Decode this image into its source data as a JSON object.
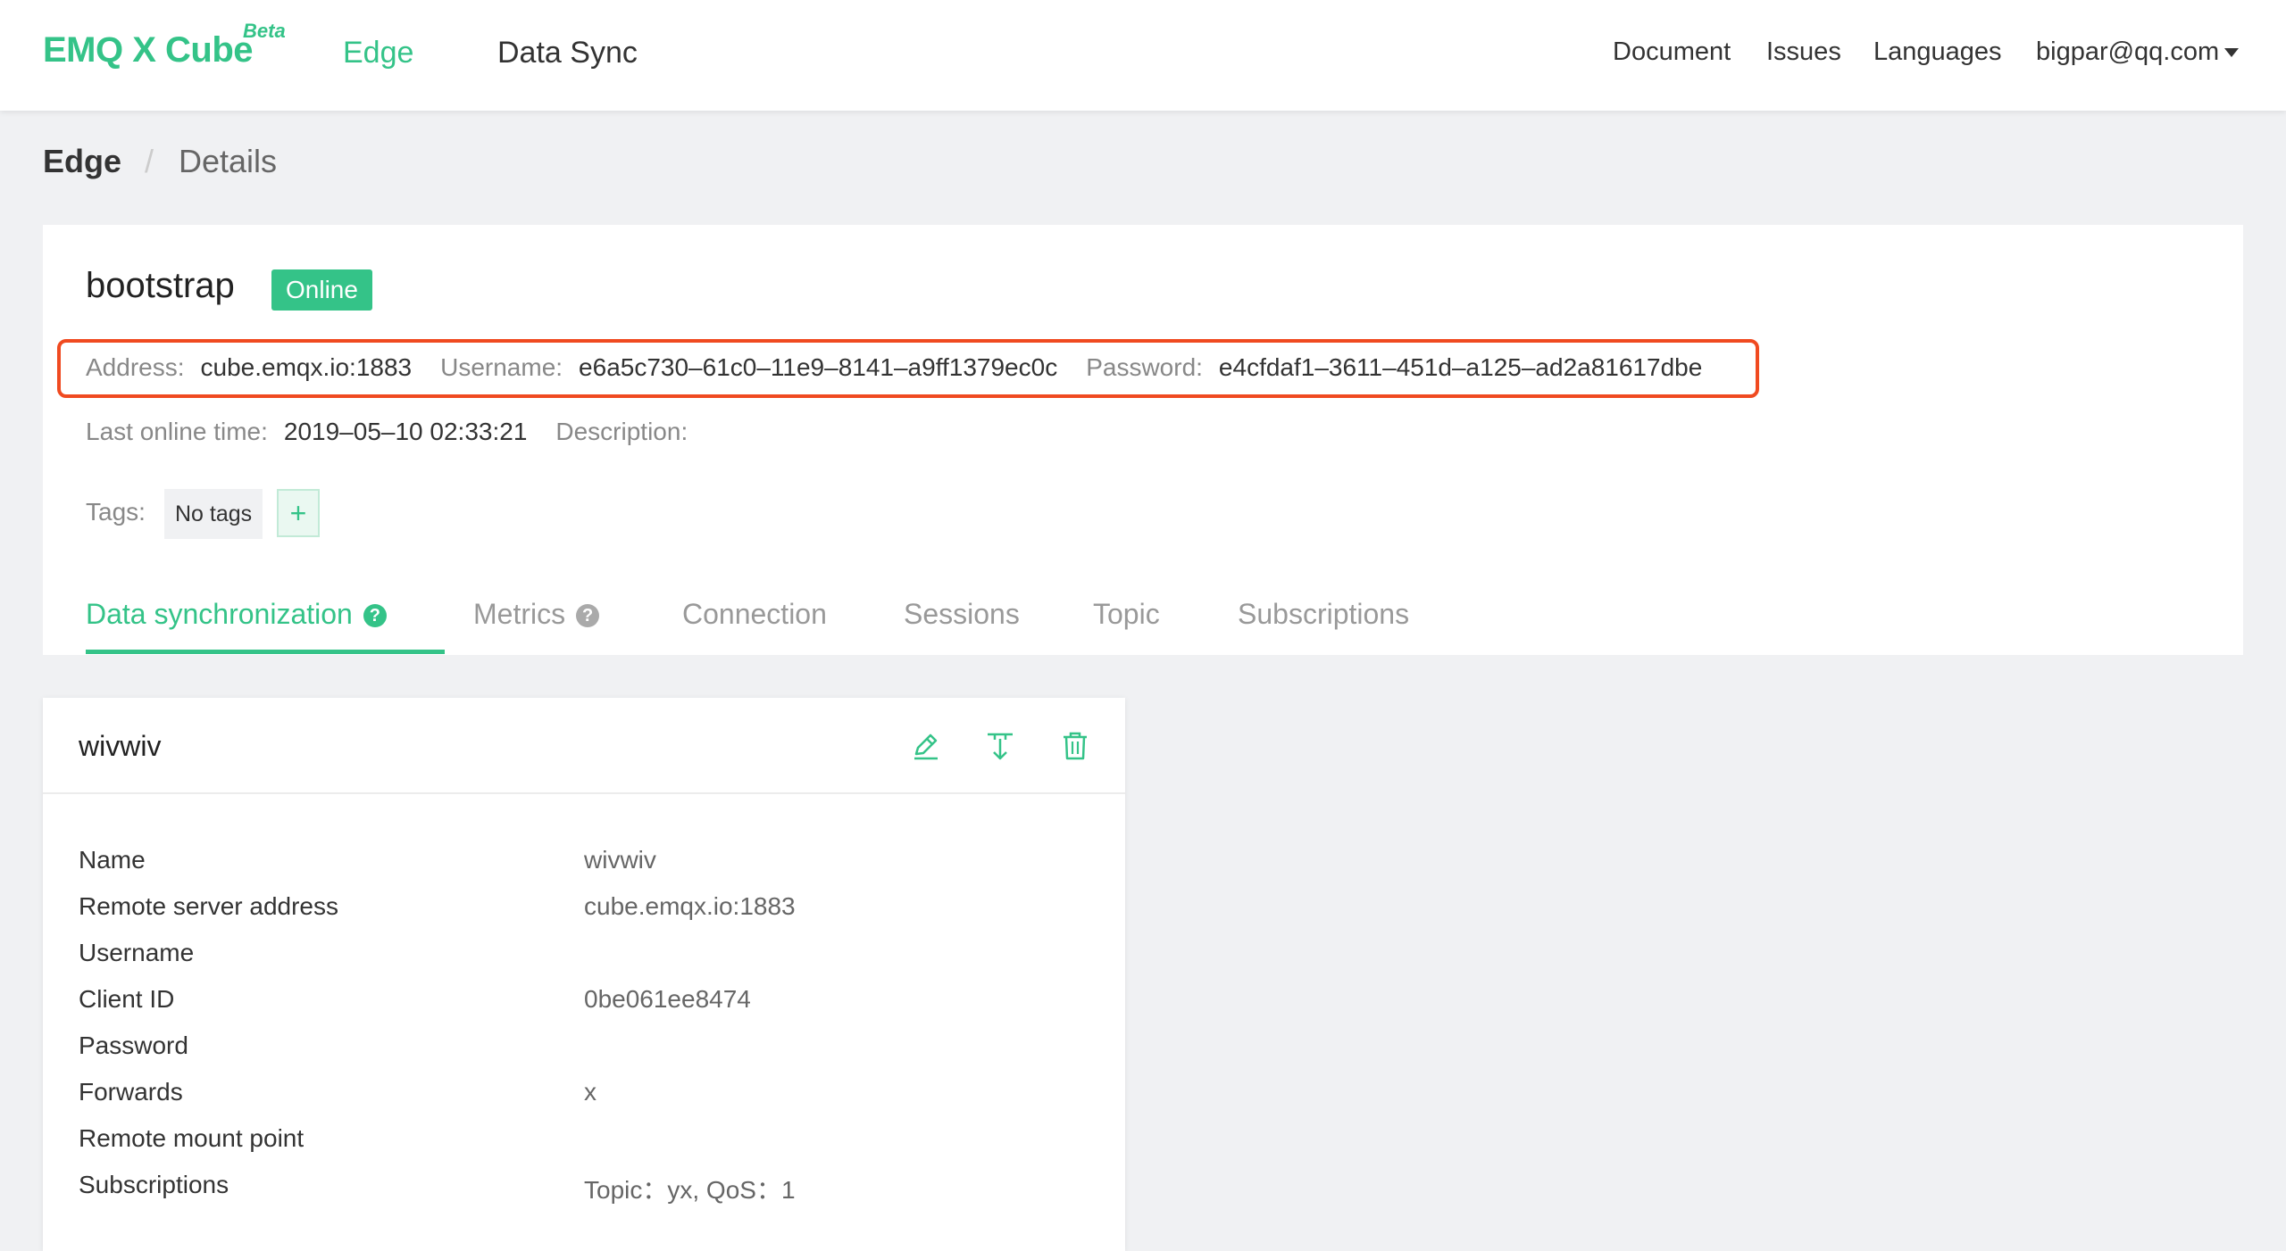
{
  "header": {
    "logo": "EMQ X Cube",
    "logo_badge": "Beta",
    "nav": {
      "edge": "Edge",
      "data_sync": "Data Sync"
    },
    "right": {
      "document": "Document",
      "issues": "Issues",
      "languages": "Languages",
      "user": "bigpar@qq.com"
    }
  },
  "breadcrumb": {
    "root": "Edge",
    "separator": "/",
    "current": "Details"
  },
  "node": {
    "name": "bootstrap",
    "status": "Online",
    "address_label": "Address:",
    "address": "cube.emqx.io:1883",
    "username_label": "Username:",
    "username": "e6a5c730–61c0–11e9–8141–a9ff1379ec0c",
    "password_label": "Password:",
    "password": "e4cfdaf1–3611–451d–a125–ad2a81617dbe",
    "last_online_label": "Last online time:",
    "last_online": "2019–05–10 02:33:21",
    "description_label": "Description:",
    "description": "",
    "tags_label": "Tags:",
    "no_tags": "No tags",
    "add_tag": "+"
  },
  "tabs": [
    {
      "label": "Data synchronization",
      "help": "?"
    },
    {
      "label": "Metrics",
      "help": "?"
    },
    {
      "label": "Connection"
    },
    {
      "label": "Sessions"
    },
    {
      "label": "Topic"
    },
    {
      "label": "Subscriptions"
    }
  ],
  "sync_card": {
    "title": "wivwiv",
    "icons": [
      "edit-icon",
      "download-icon",
      "delete-icon"
    ],
    "fields": [
      {
        "key": "Name",
        "value": "wivwiv"
      },
      {
        "key": "Remote server address",
        "value": "cube.emqx.io:1883"
      },
      {
        "key": "Username",
        "value": ""
      },
      {
        "key": "Client ID",
        "value": "0be061ee8474"
      },
      {
        "key": "Password",
        "value": ""
      },
      {
        "key": "Forwards",
        "value": "x"
      },
      {
        "key": "Remote mount point",
        "value": ""
      },
      {
        "key": "Subscriptions",
        "value": "Topic：yx, QoS：1"
      }
    ]
  },
  "colors": {
    "accent": "#34c388",
    "highlight": "#f04a20",
    "background": "#f0f1f3"
  }
}
